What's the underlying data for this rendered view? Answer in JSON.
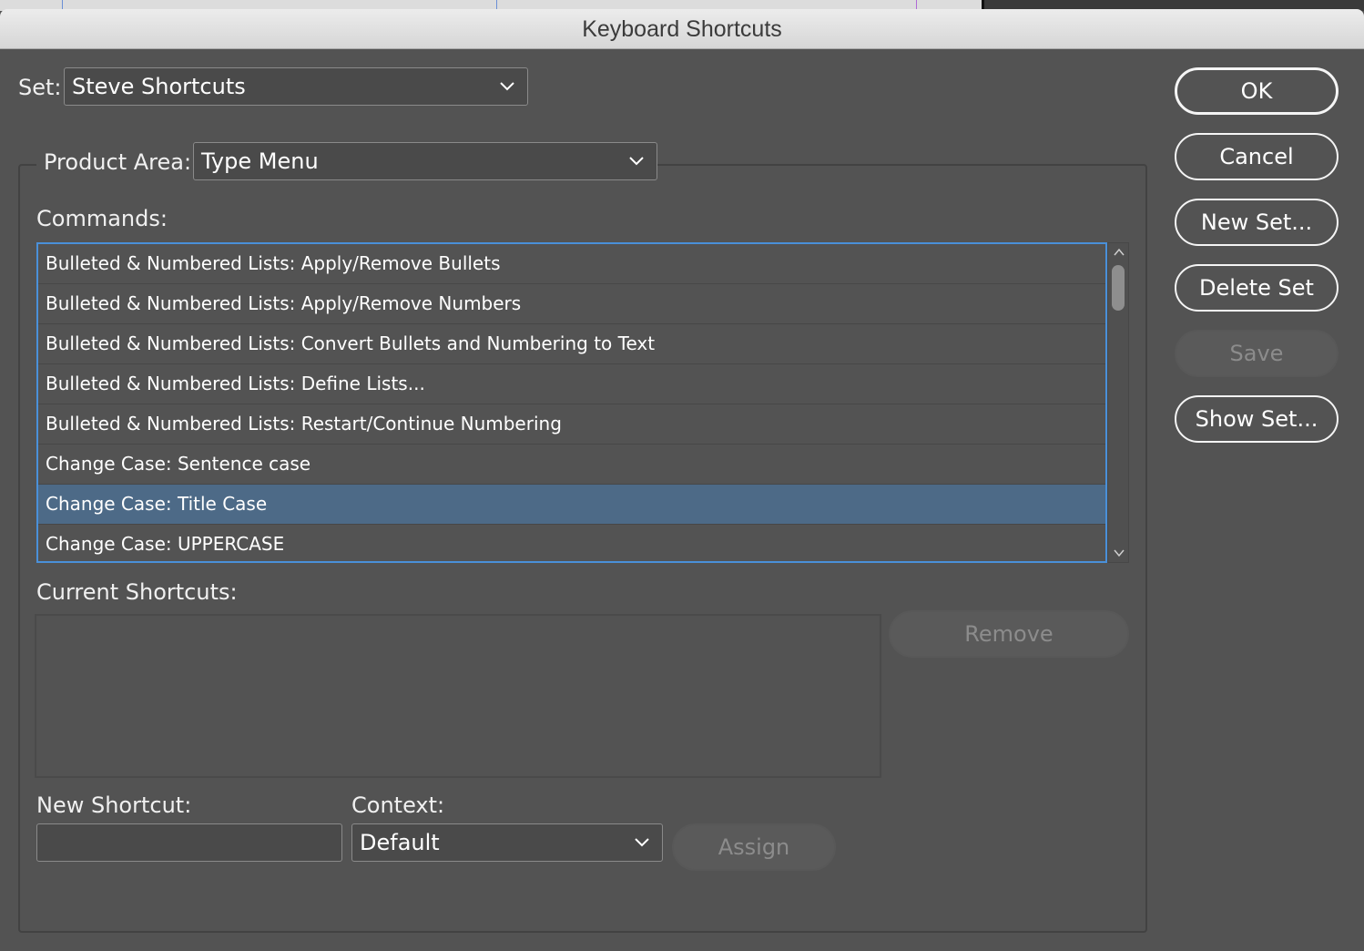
{
  "window": {
    "title": "Keyboard Shortcuts"
  },
  "set": {
    "label": "Set:",
    "value": "Steve Shortcuts"
  },
  "product_area": {
    "label": "Product Area:",
    "value": "Type Menu"
  },
  "commands": {
    "label": "Commands:",
    "items": [
      "Bulleted & Numbered Lists: Apply/Remove Bullets",
      "Bulleted & Numbered Lists: Apply/Remove Numbers",
      "Bulleted & Numbered Lists: Convert Bullets and Numbering to Text",
      "Bulleted & Numbered Lists: Define Lists...",
      "Bulleted & Numbered Lists: Restart/Continue Numbering",
      "Change Case: Sentence case",
      "Change Case: Title Case",
      "Change Case: UPPERCASE"
    ],
    "selected_index": 6
  },
  "current_shortcuts": {
    "label": "Current Shortcuts:",
    "remove_label": "Remove"
  },
  "new_shortcut": {
    "label": "New Shortcut:",
    "value": ""
  },
  "context": {
    "label": "Context:",
    "value": "Default"
  },
  "assign_label": "Assign",
  "side_buttons": {
    "ok": "OK",
    "cancel": "Cancel",
    "new_set": "New Set...",
    "delete_set": "Delete Set",
    "save": "Save",
    "show_set": "Show Set..."
  },
  "colors": {
    "selection": "#4d6a87",
    "list_focus": "#4a90d9",
    "dialog_bg": "#535353"
  }
}
